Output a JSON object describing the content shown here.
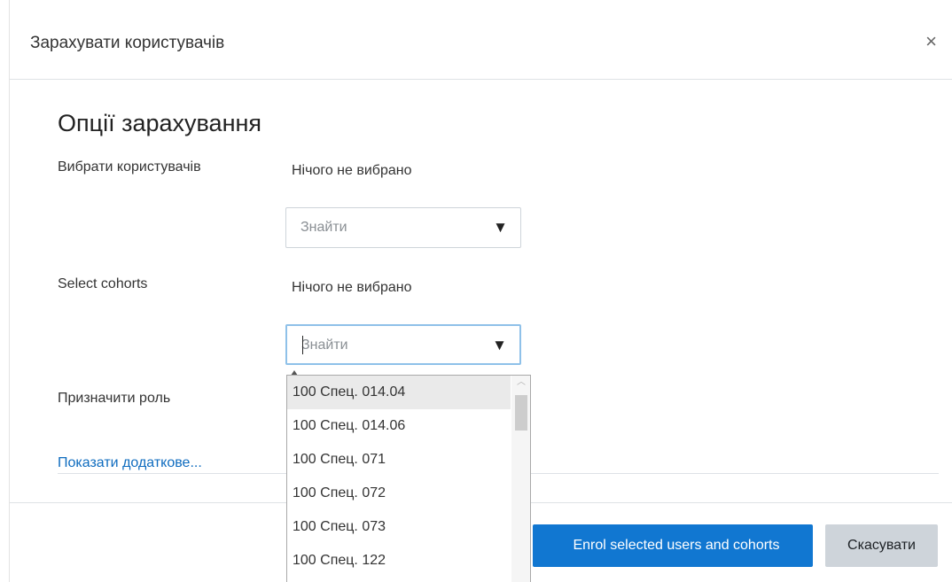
{
  "dialog": {
    "title": "Зарахувати користувачів",
    "close_glyph": "×"
  },
  "section": {
    "title": "Опції зарахування"
  },
  "fields": {
    "select_users": {
      "label": "Вибрати користувачів",
      "selection": "Нічого не вибрано",
      "search_placeholder": "Знайти",
      "caret_glyph": "▼"
    },
    "select_cohorts": {
      "label": "Select cohorts",
      "selection": "Нічого не вибрано",
      "search_placeholder": "Знайти",
      "caret_glyph": "▼"
    },
    "assign_role": {
      "label": "Призначити роль"
    }
  },
  "show_more_link": "Показати додаткове...",
  "cohort_options": [
    "100 Спец. 014.04",
    "100 Спец. 014.06",
    "100 Спец. 071",
    "100 Спец. 072",
    "100 Спец. 073",
    "100 Спец. 122"
  ],
  "footer": {
    "enrol_label": "Enrol selected users and cohorts",
    "cancel_label": "Скасувати"
  },
  "colors": {
    "primary": "#1177d1",
    "link": "#0f6cbf",
    "focus": "#8fc1e9",
    "secondary_button": "#ced4da"
  }
}
